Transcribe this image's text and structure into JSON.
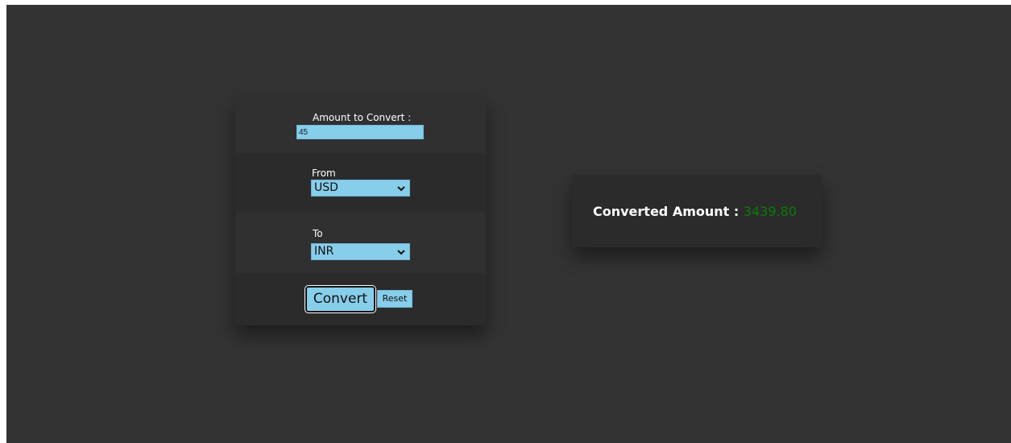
{
  "form": {
    "amount_label": "Amount to Convert :",
    "amount_value": "45",
    "from_label": "From",
    "from_selected": "USD",
    "to_label": "To",
    "to_selected": "INR",
    "convert_label": "Convert",
    "reset_label": "Reset"
  },
  "result": {
    "label": "Converted Amount :",
    "value": "3439.80"
  },
  "icons": {
    "select_arrow": "chevron-down-icon"
  },
  "colors": {
    "background": "#333333",
    "accent": "#87ceeb",
    "result_value": "#0a7a0a",
    "text": "#ffffff"
  }
}
